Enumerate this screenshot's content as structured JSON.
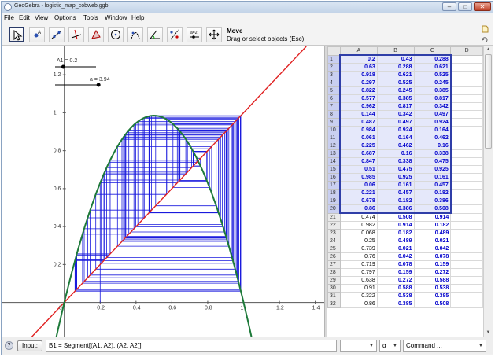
{
  "window": {
    "title": "GeoGebra - logistic_map_cobweb.ggb",
    "minimize": "–",
    "maximize": "□",
    "close": "✕"
  },
  "menu": [
    "File",
    "Edit",
    "View",
    "Options",
    "Tools",
    "Window",
    "Help"
  ],
  "toolbar": {
    "tools": [
      "move",
      "point",
      "line",
      "perpendicular",
      "polygon",
      "circle",
      "conic",
      "angle",
      "reflect",
      "slider",
      "move-view"
    ],
    "slider_tool_label": "a=2",
    "active_tool_title": "Move",
    "active_tool_help": "Drag or select objects (Esc)"
  },
  "graphics": {
    "slider_A1_label": "A1 = 0.2",
    "slider_A1_value": 0.2,
    "slider_a_label": "a = 3.94",
    "slider_a_value": 3.94,
    "slider_a_range": [
      0,
      4
    ],
    "x_ticks": [
      "0.2",
      "0.4",
      "0.6",
      "0.8",
      "1",
      "1.2",
      "1.4"
    ],
    "y_ticks": [
      "1.2",
      "1",
      "0.8",
      "0.6",
      "0.4",
      "0.2"
    ],
    "origin_label": "0",
    "x_range": [
      -0.35,
      1.45
    ],
    "y_range": [
      -0.18,
      1.35
    ],
    "colors": {
      "identity_line": "#e02020",
      "parabola": "#1e7a3a",
      "cobweb": "#1a1add",
      "axes": "#555555"
    }
  },
  "spreadsheet": {
    "columns": [
      "A",
      "B",
      "C",
      "D"
    ],
    "rows": [
      {
        "n": "1",
        "a": "0.2",
        "b": "0.43",
        "c": "0.288"
      },
      {
        "n": "2",
        "a": "0.63",
        "b": "0.288",
        "c": "0.621"
      },
      {
        "n": "3",
        "a": "0.918",
        "b": "0.621",
        "c": "0.525"
      },
      {
        "n": "4",
        "a": "0.297",
        "b": "0.525",
        "c": "0.245"
      },
      {
        "n": "5",
        "a": "0.822",
        "b": "0.245",
        "c": "0.385"
      },
      {
        "n": "6",
        "a": "0.577",
        "b": "0.385",
        "c": "0.817"
      },
      {
        "n": "7",
        "a": "0.962",
        "b": "0.817",
        "c": "0.342"
      },
      {
        "n": "8",
        "a": "0.144",
        "b": "0.342",
        "c": "0.497"
      },
      {
        "n": "9",
        "a": "0.487",
        "b": "0.497",
        "c": "0.924"
      },
      {
        "n": "10",
        "a": "0.984",
        "b": "0.924",
        "c": "0.164"
      },
      {
        "n": "11",
        "a": "0.061",
        "b": "0.164",
        "c": "0.462"
      },
      {
        "n": "12",
        "a": "0.225",
        "b": "0.462",
        "c": "0.16"
      },
      {
        "n": "13",
        "a": "0.687",
        "b": "0.16",
        "c": "0.338"
      },
      {
        "n": "14",
        "a": "0.847",
        "b": "0.338",
        "c": "0.475"
      },
      {
        "n": "15",
        "a": "0.51",
        "b": "0.475",
        "c": "0.925"
      },
      {
        "n": "16",
        "a": "0.985",
        "b": "0.925",
        "c": "0.161"
      },
      {
        "n": "17",
        "a": "0.06",
        "b": "0.161",
        "c": "0.457"
      },
      {
        "n": "18",
        "a": "0.221",
        "b": "0.457",
        "c": "0.182"
      },
      {
        "n": "19",
        "a": "0.678",
        "b": "0.182",
        "c": "0.386"
      },
      {
        "n": "20",
        "a": "0.86",
        "b": "0.386",
        "c": "0.508"
      },
      {
        "n": "21",
        "a": "0.474",
        "b": "0.508",
        "c": "0.914"
      },
      {
        "n": "22",
        "a": "0.982",
        "b": "0.914",
        "c": "0.182"
      },
      {
        "n": "23",
        "a": "0.068",
        "b": "0.182",
        "c": "0.489"
      },
      {
        "n": "24",
        "a": "0.25",
        "b": "0.489",
        "c": "0.021"
      },
      {
        "n": "25",
        "a": "0.739",
        "b": "0.021",
        "c": "0.042"
      },
      {
        "n": "26",
        "a": "0.76",
        "b": "0.042",
        "c": "0.078"
      },
      {
        "n": "27",
        "a": "0.719",
        "b": "0.078",
        "c": "0.159"
      },
      {
        "n": "28",
        "a": "0.797",
        "b": "0.159",
        "c": "0.272"
      },
      {
        "n": "29",
        "a": "0.638",
        "b": "0.272",
        "c": "0.588"
      },
      {
        "n": "30",
        "a": "0.91",
        "b": "0.588",
        "c": "0.538"
      },
      {
        "n": "31",
        "a": "0.322",
        "b": "0.538",
        "c": "0.385"
      },
      {
        "n": "32",
        "a": "0.86",
        "b": "0.385",
        "c": "0.508"
      }
    ]
  },
  "input_bar": {
    "help_icon": "?",
    "input_button": "Input:",
    "input_value": "B1 = Segment[(A1, A2), (A2, A2)]",
    "symbol_dropdown": "",
    "alpha_dropdown": "α",
    "command_dropdown": "Command ..."
  }
}
